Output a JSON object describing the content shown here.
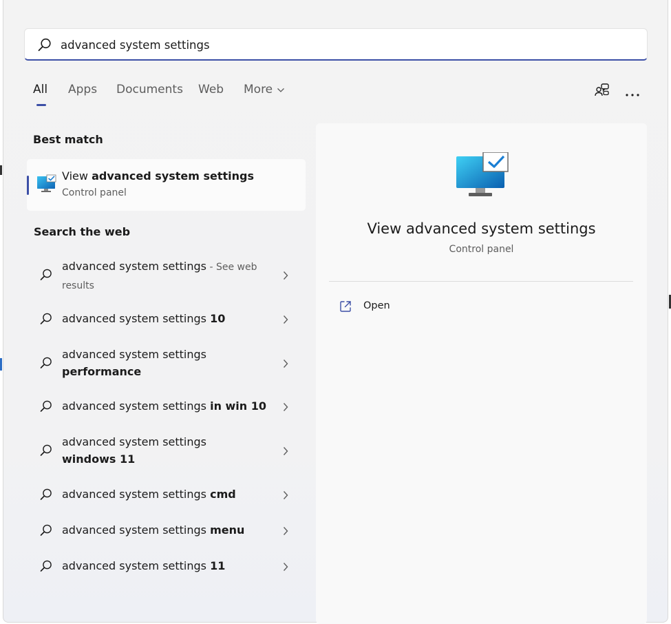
{
  "search": {
    "value": "advanced system settings",
    "icon": "search-icon"
  },
  "tabs": [
    {
      "label": "All",
      "active": true
    },
    {
      "label": "Apps"
    },
    {
      "label": "Documents"
    },
    {
      "label": "Web"
    },
    {
      "label": "More"
    }
  ],
  "top_icons": [
    "account-switch-icon",
    "more-options-icon"
  ],
  "best_match": {
    "section_title": "Best match",
    "title_prefix": "View ",
    "title_bold": "advanced system settings",
    "subtitle": "Control panel",
    "icon": "monitor-check-icon"
  },
  "web": {
    "section_title": "Search the web",
    "rows": [
      {
        "text": "advanced system settings",
        "bold": "",
        "hint": " - See web results"
      },
      {
        "text": "advanced system settings ",
        "bold": "10",
        "hint": ""
      },
      {
        "text": "advanced system settings",
        "bold": "performance",
        "hint": ""
      },
      {
        "text": "advanced system settings ",
        "bold": "in win 10",
        "hint": ""
      },
      {
        "text": "advanced system settings",
        "bold": "windows 11",
        "hint": ""
      },
      {
        "text": "advanced system settings ",
        "bold": "cmd",
        "hint": ""
      },
      {
        "text": "advanced system settings ",
        "bold": "menu",
        "hint": ""
      },
      {
        "text": "advanced system settings ",
        "bold": "11",
        "hint": ""
      }
    ]
  },
  "preview": {
    "title": "View advanced system settings",
    "subtitle": "Control panel",
    "open_label": "Open"
  },
  "colors": {
    "accent": "#3c4fa6",
    "panel_bg": "#f3f3f3",
    "card_bg": "#fbfbfb"
  }
}
